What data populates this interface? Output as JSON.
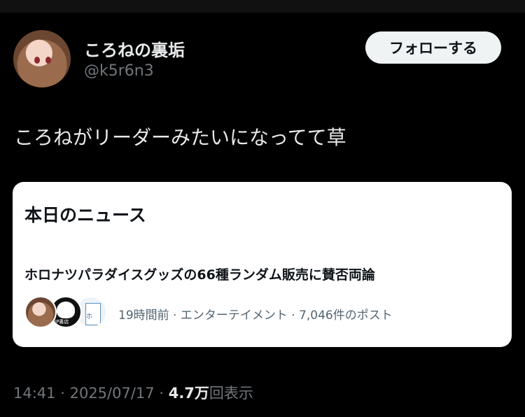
{
  "author": {
    "display_name": "ころねの裏垢",
    "handle": "@k5r6n3",
    "avatar": "anime-girl-avatar"
  },
  "follow_button_label": "フォローする",
  "tweet_text": "ころねがリーダーみたいになってて草",
  "news_card": {
    "heading": "本日のニュース",
    "headline": "ホロナツパラダイスグッズの66種ランダム販売に賛否両論",
    "avatars": [
      "anime-girl-avatar",
      "ip-shoten-avatar",
      "milk-carton-avatar"
    ],
    "avatar_label_small": "IP書店",
    "carton_text": "ホ",
    "meta": "19時間前 · エンターテイメント · 7,046件のポスト"
  },
  "footer": {
    "time": "14:41",
    "date": "2025/07/17",
    "separator": "·",
    "views_count": "4.7万",
    "views_label": "回表示"
  }
}
